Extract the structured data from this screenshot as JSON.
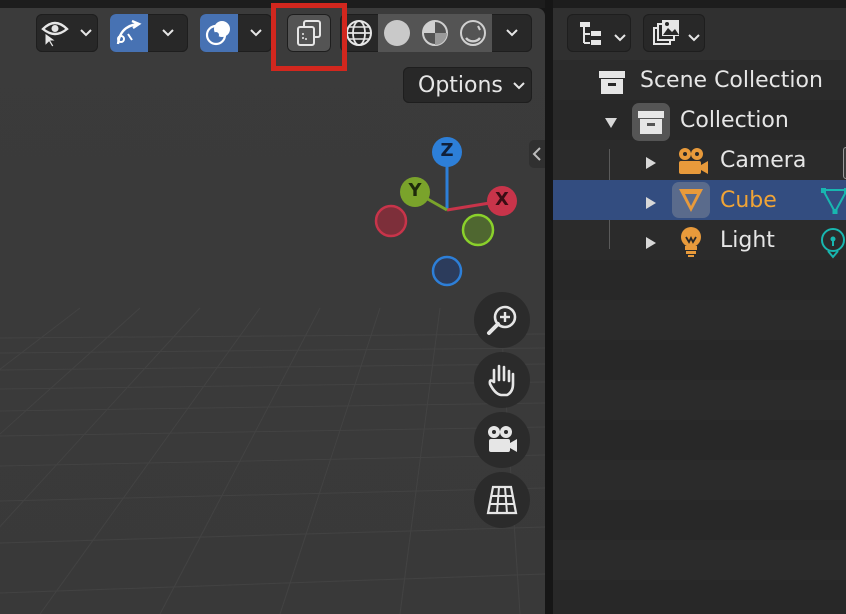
{
  "colors": {
    "viewport_bg": "#3b3b3b",
    "accent_blue": "#4772b3",
    "selected_row": "#334d80",
    "highlight_box": "#d2271e",
    "axis_x": "#c8344a",
    "axis_y": "#7aa32b",
    "axis_z": "#2d7fd8",
    "object_orange": "#e89a3b",
    "data_teal": "#18b7b0"
  },
  "header": {
    "view_object_types_icon": "eye-cursor-icon",
    "gizmo_icon": "gizmo-curve-icon",
    "overlay_icon": "overlay-circles-icon",
    "xray_icon": "xray-toggle-icon",
    "shading_modes": [
      "wireframe",
      "solid",
      "material-preview",
      "rendered"
    ],
    "options_label": "Options"
  },
  "gizmo": {
    "x_label": "X",
    "y_label": "Y",
    "z_label": "Z"
  },
  "nav_buttons": [
    "zoom-in-icon",
    "hand-pan-icon",
    "camera-view-icon",
    "perspective-grid-icon"
  ],
  "outliner": {
    "display_mode_icon": "outliner-tree-icon",
    "filter_icon": "image-filter-icon",
    "scene_collection": "Scene Collection",
    "collection": "Collection",
    "items": [
      {
        "label": "Camera",
        "selected": false
      },
      {
        "label": "Cube",
        "selected": true
      },
      {
        "label": "Light",
        "selected": false
      }
    ]
  }
}
